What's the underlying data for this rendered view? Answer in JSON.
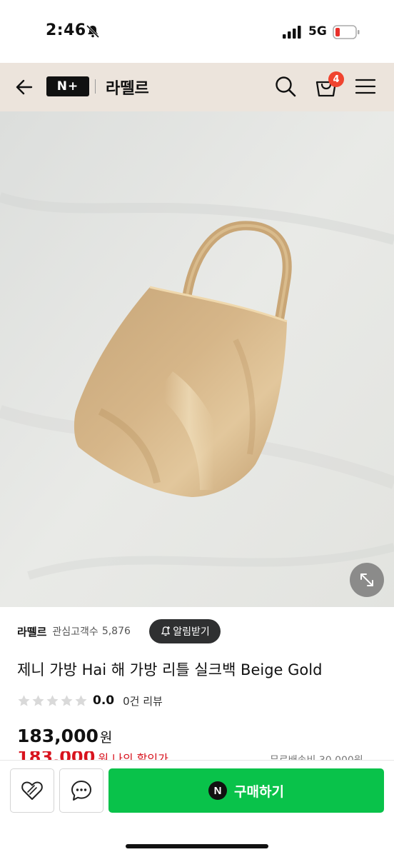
{
  "status_bar": {
    "time": "2:46",
    "network": "5G"
  },
  "header": {
    "logo_text": "N+",
    "store_name": "라뗄르",
    "cart_count": "4"
  },
  "store": {
    "name": "라뗄르",
    "followers_label": "관심고객수",
    "followers_count": "5,876",
    "alarm_label": "알림받기"
  },
  "product": {
    "title": "제니 가방 Hai 해 가방 리틀 실크백 Beige Gold",
    "rating": "0.0",
    "rating_max": 5,
    "review_count": "0건 리뷰",
    "price": "183,000",
    "price_unit": "원",
    "discount_price": "183,000",
    "discount_text": "원 나의 할인가",
    "shipping_text": "무료배송비 30,000원"
  },
  "bottom_bar": {
    "buy_label": "구매하기",
    "buy_icon_text": "N"
  },
  "colors": {
    "header_bg": "#ece4dc",
    "buy_green": "#09c24a",
    "badge_red": "#f0442f",
    "discount_red": "#d8131e"
  },
  "icons": [
    "back-arrow-icon",
    "search-icon",
    "shopping-bag-icon",
    "hamburger-menu-icon",
    "expand-icon",
    "bell-plus-icon",
    "star-icon",
    "heart-icon",
    "chat-bubble-icon"
  ]
}
